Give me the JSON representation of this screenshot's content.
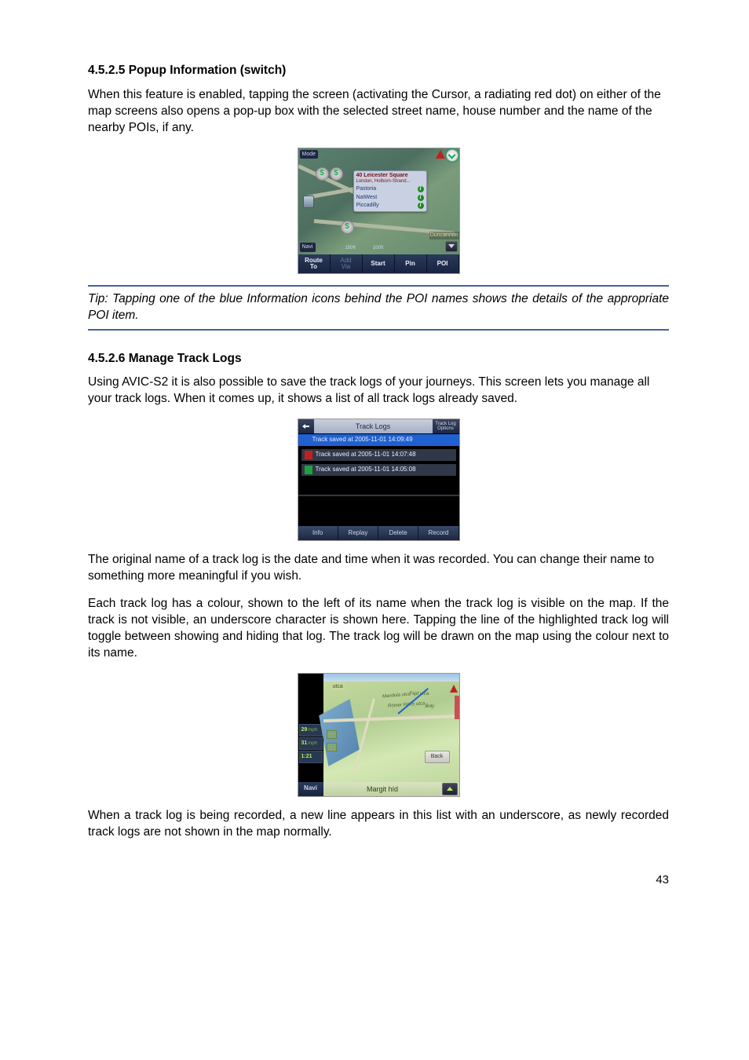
{
  "section_4525": {
    "heading": "4.5.2.5  Popup Information (switch)",
    "para1": "When this feature is enabled, tapping the screen (activating the Cursor, a radiating red dot) on either of the map screens also opens a pop-up box with the selected street name, house number and the name of the nearby POIs, if any.",
    "tip": "Tip: Tapping one of the blue Information icons behind the POI names shows the details of the appropriate POI item."
  },
  "fig1": {
    "mode_label": "Mode",
    "popup_title": "40 Leicester Square",
    "popup_sub": "London, Holborn-Strand...",
    "popup_row1": "Pastoria",
    "popup_row2": "NatWest",
    "popup_row3": "Piccadilly",
    "scale1": "150ft",
    "scale2": "100ft",
    "street_mid": "Duncannon",
    "navi_label": "Navi",
    "btn_route": "Route\nTo",
    "btn_add": "Add\nVia",
    "btn_start": "Start",
    "btn_pin": "Pin",
    "btn_poi": "POI"
  },
  "section_4526": {
    "heading": "4.5.2.6  Manage Track Logs",
    "para1": "Using AVIC-S2 it is also possible to save the track logs of your journeys. This screen lets you manage all your track logs. When it comes up, it shows a list of all track logs already saved.",
    "para2": "The original name of a track log is the date and time when it was recorded. You can change their name to something more meaningful if you wish.",
    "para3": "Each track log has a colour, shown to the left of its name when the track log is visible on the map. If the track is not visible, an underscore character is shown here. Tapping the line of the highlighted track log will toggle between showing and hiding that log. The track log will be drawn on the map using the colour next to its name.",
    "para4": "When a track log is being recorded, a new line appears in this list with an underscore, as newly recorded track logs are not shown in the map normally."
  },
  "fig2": {
    "title": "Track Logs",
    "options": "Track Log\nOptions",
    "row1": "Track saved at 2005-11-01 14:09:49",
    "row2": "Track saved at 2005-11-01 14:07:48",
    "row3": "Track saved at 2005-11-01 14:05:08",
    "btn_info": "Info",
    "btn_replay": "Replay",
    "btn_delete": "Delete",
    "btn_record": "Record"
  },
  "fig3": {
    "utca_label": "utca",
    "street1": "Mandula utca",
    "street2": "Fajd utca",
    "street3": "Rómer Flóris utca",
    "street4": "Boly",
    "speed1_val": "29",
    "speed1_unit": "mph",
    "speed2_val": "31",
    "speed2_unit": "mph",
    "time_val": "1:21",
    "back_label": "Back",
    "navi_label": "Navi",
    "bottom_street": "Margit híd"
  },
  "page_number": "43"
}
